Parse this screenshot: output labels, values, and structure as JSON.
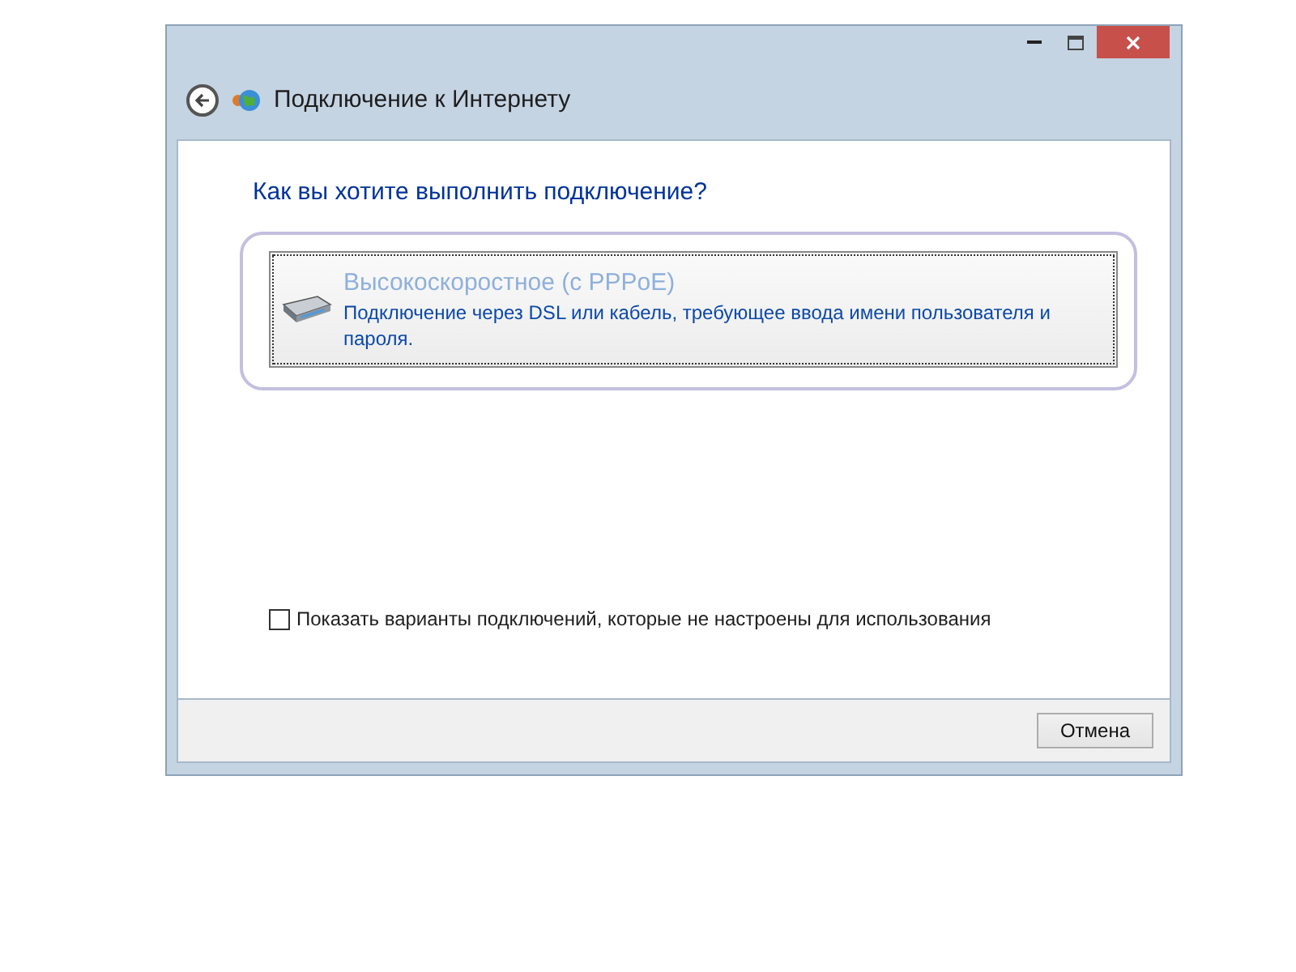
{
  "window": {
    "title": "Подключение к Интернету"
  },
  "heading": "Как вы хотите выполнить подключение?",
  "options": [
    {
      "title": "Высокоскоростное (с PPPoE)",
      "description": "Подключение через DSL или кабель, требующее ввода имени пользователя и пароля.",
      "selected": true
    }
  ],
  "checkbox": {
    "label": "Показать варианты подключений, которые не настроены для использования",
    "checked": false
  },
  "buttons": [
    "Отмена"
  ]
}
